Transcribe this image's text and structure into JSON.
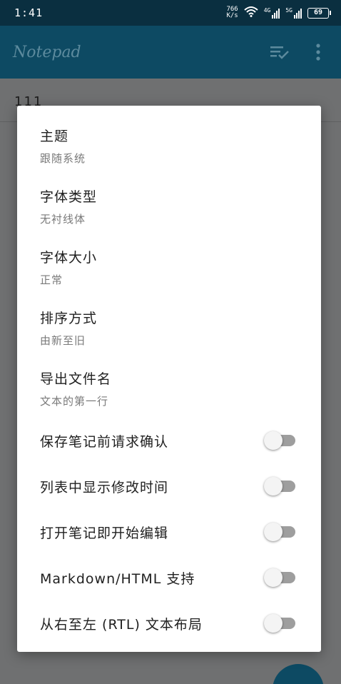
{
  "status_bar": {
    "time": "1:41",
    "net_speed_value": "766",
    "net_speed_unit": "K/s",
    "signal_1_label": "4G",
    "signal_2_label": "5G",
    "battery_level": "69"
  },
  "app_bar": {
    "title": "Notepad",
    "sort_icon": "sort-check-icon",
    "overflow_icon": "more-vert-icon"
  },
  "list": {
    "first_item_text": "111"
  },
  "dialog": {
    "preferences": [
      {
        "title": "主题",
        "summary": "跟随系统"
      },
      {
        "title": "字体类型",
        "summary": "无衬线体"
      },
      {
        "title": "字体大小",
        "summary": "正常"
      },
      {
        "title": "排序方式",
        "summary": "由新至旧"
      },
      {
        "title": "导出文件名",
        "summary": "文本的第一行"
      }
    ],
    "toggles": [
      {
        "label": "保存笔记前请求确认",
        "on": false
      },
      {
        "label": "列表中显示修改时间",
        "on": false
      },
      {
        "label": "打开笔记即开始编辑",
        "on": false
      },
      {
        "label": "Markdown/HTML 支持",
        "on": false
      },
      {
        "label": "从右至左 (RTL) 文本布局",
        "on": false
      }
    ]
  },
  "colors": {
    "status_bar": "#0a2f40",
    "app_bar": "#0d4a63",
    "scrim_background": "#6f7071",
    "switch_track_off": "#9e9e9e"
  }
}
